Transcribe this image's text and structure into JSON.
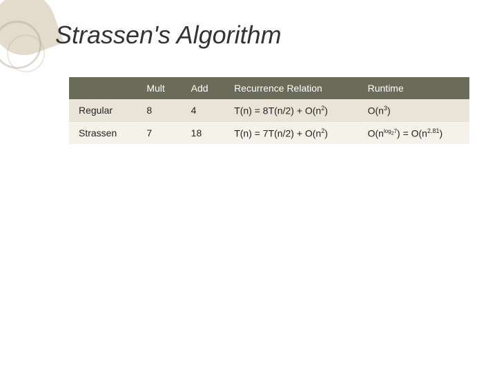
{
  "page": {
    "title": "Strassen's Algorithm",
    "table": {
      "headers": [
        "",
        "Mult",
        "Add",
        "Recurrence Relation",
        "Runtime"
      ],
      "rows": [
        {
          "label": "Regular",
          "mult": "8",
          "add": "4",
          "recurrence": "T(n) = 8T(n/2) + O(n",
          "recurrence_sup": "2",
          "recurrence_suffix": ")",
          "runtime": "O(n",
          "runtime_sup": "3",
          "runtime_suffix": ")"
        },
        {
          "label": "Strassen",
          "mult": "7",
          "add": "18",
          "recurrence": "T(n) = 7T(n/2) + O(n",
          "recurrence_sup": "2",
          "recurrence_suffix": ")",
          "runtime_prefix": "O(n",
          "runtime_small_sup": "log",
          "runtime_small_sub": "2",
          "runtime_small_7": "7",
          "runtime_mid": ") = O(n",
          "runtime_sup": "2.81",
          "runtime_suffix": ")"
        }
      ]
    }
  }
}
